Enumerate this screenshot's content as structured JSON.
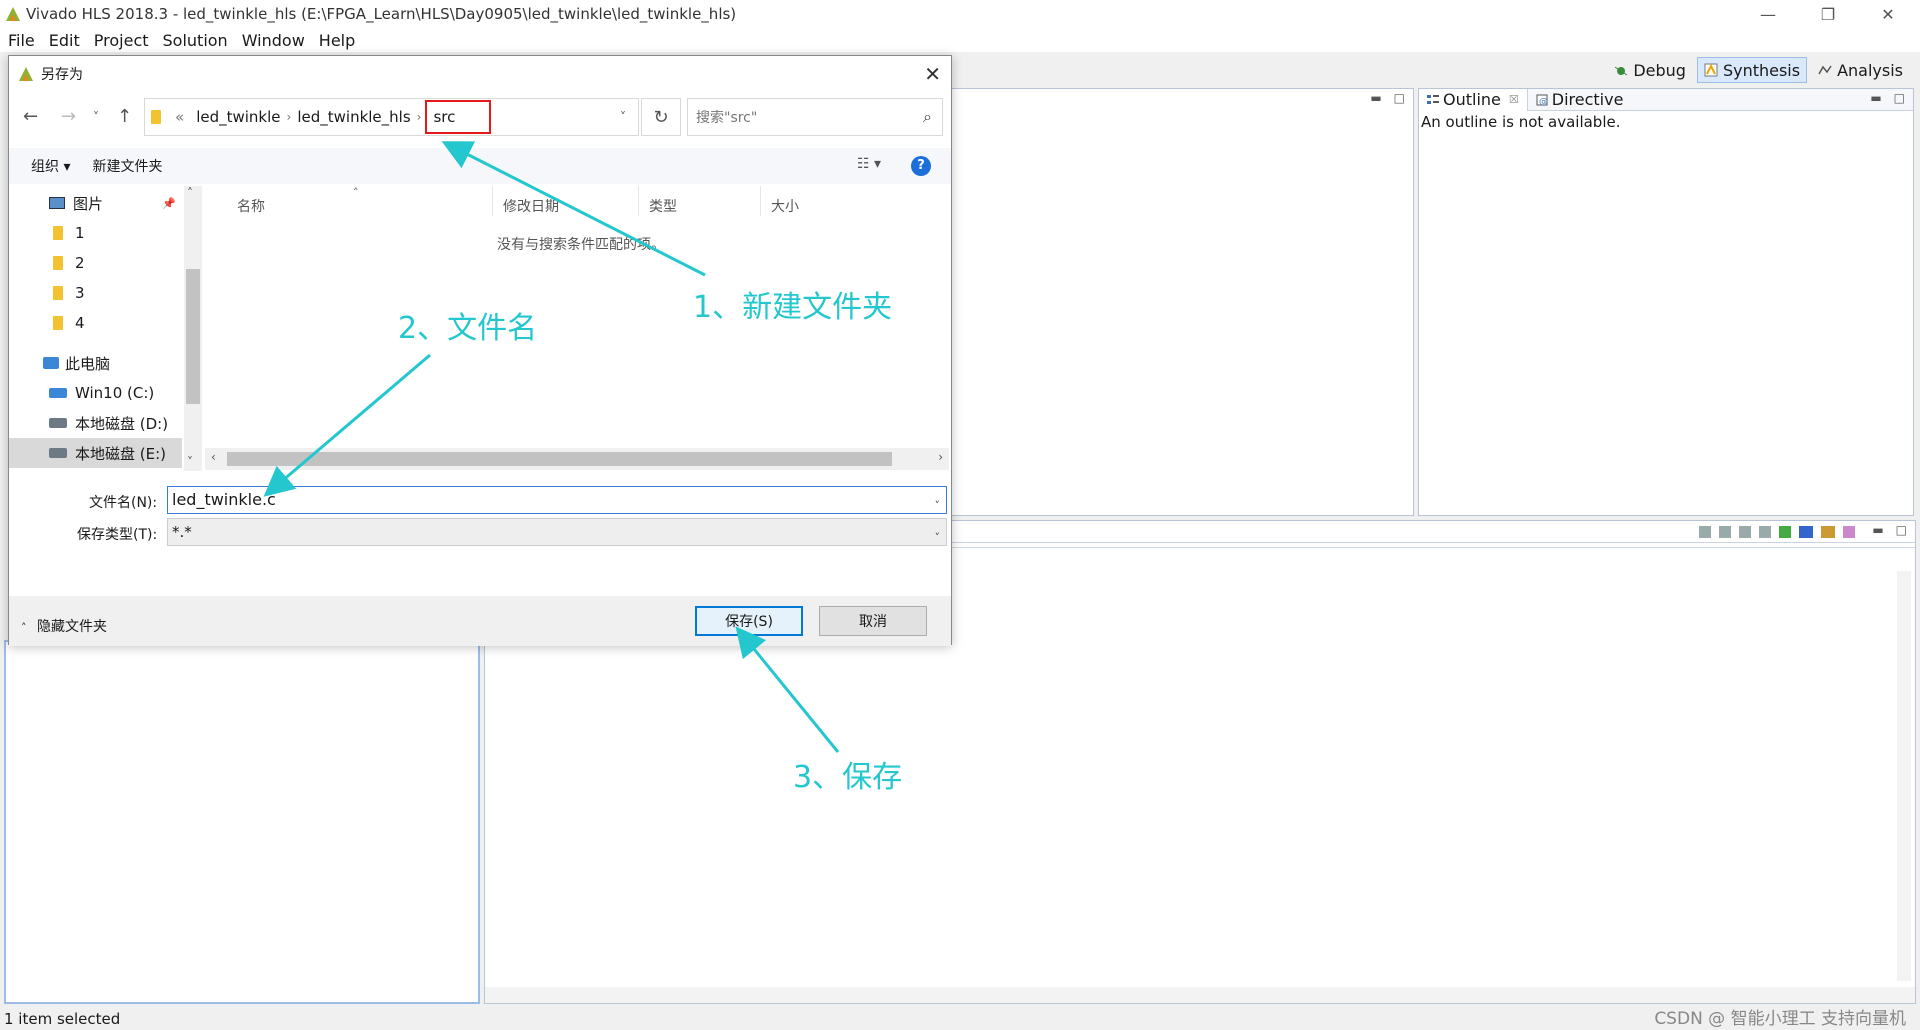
{
  "window": {
    "title": "Vivado HLS 2018.3 - led_twinkle_hls (E:\\FPGA_Learn\\HLS\\Day0905\\led_twinkle\\led_twinkle_hls)",
    "minimize": "—",
    "restore": "❐",
    "close": "✕"
  },
  "menu": [
    "File",
    "Edit",
    "Project",
    "Solution",
    "Window",
    "Help"
  ],
  "perspectives": {
    "debug": "Debug",
    "synthesis": "Synthesis",
    "analysis": "Analysis"
  },
  "outline": {
    "tab_label": "Outline",
    "tab_close": "☒",
    "directive_label": "Directive",
    "message": "An outline is not available."
  },
  "status": {
    "text": "1 item selected"
  },
  "watermark": "CSDN @ 智能小理工 支持向量机",
  "dialog": {
    "title": "另存为",
    "close": "✕",
    "breadcrumb": [
      "«",
      "led_twinkle",
      "led_twinkle_hls",
      "src"
    ],
    "search_placeholder": "搜索\"src\"",
    "toolbar": {
      "organize": "组织 ▾",
      "new_folder": "新建文件夹",
      "help": "?"
    },
    "tree": [
      {
        "label": "图片"
      },
      {
        "label": "1"
      },
      {
        "label": "2"
      },
      {
        "label": "3"
      },
      {
        "label": "4"
      },
      {
        "label": "此电脑"
      },
      {
        "label": "Win10 (C:)"
      },
      {
        "label": "本地磁盘 (D:)"
      },
      {
        "label": "本地磁盘 (E:)"
      }
    ],
    "columns": [
      "名称",
      "修改日期",
      "类型",
      "大小"
    ],
    "empty_message": "没有与搜索条件匹配的项。",
    "filename_label": "文件名(N):",
    "filename_value": "led_twinkle.c",
    "filetype_label": "保存类型(T):",
    "filetype_value": "*.*",
    "hide_folders": "隐藏文件夹",
    "save_label": "保存(S)",
    "cancel_label": "取消"
  },
  "annotations": {
    "step1": "1、新建文件夹",
    "step2": "2、文件名",
    "step3": "3、保存",
    "color": "#23c7cd"
  }
}
